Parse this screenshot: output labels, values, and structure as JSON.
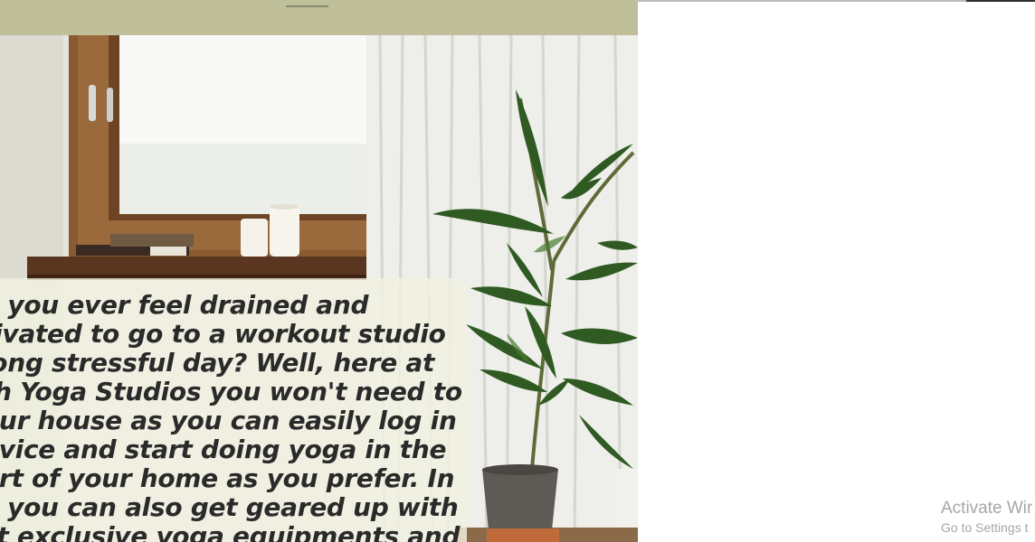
{
  "hero": {
    "lines": [
      "o you ever feel drained and",
      "tivated to go to a workout studio",
      " long stressful day? Well, here at",
      "th Yoga Studios you won't need to",
      "our house as you can easily log in",
      "evice and start doing yoga in the",
      "ort of your home as you prefer. In",
      "e you can also get geared up with",
      "st exclusive yoga equipments and"
    ]
  },
  "watermark": {
    "title": "Activate Wir",
    "subtitle": "Go to Settings t"
  },
  "colors": {
    "navbar": "#bfc09a",
    "card": "#f2f2e2",
    "text": "#2a2a2a",
    "watermark": "#a7a7a7"
  },
  "icons": [
    "plant-image",
    "window-image",
    "candle-image"
  ]
}
